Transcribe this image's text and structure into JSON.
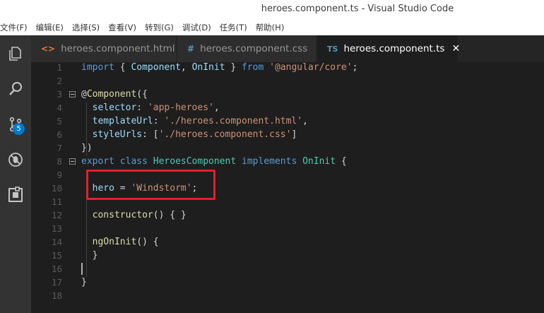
{
  "window": {
    "title": "heroes.component.ts - Visual Studio Code"
  },
  "menu": [
    "文件(F)",
    "编辑(E)",
    "选择(S)",
    "查看(V)",
    "转到(G)",
    "调试(D)",
    "任务(T)",
    "帮助(H)"
  ],
  "activity": {
    "scm_badge": "5"
  },
  "tabs": [
    {
      "icon": "<>",
      "label": "heroes.component.html"
    },
    {
      "icon": "#",
      "label": "heroes.component.css"
    },
    {
      "icon": "TS",
      "label": "heroes.component.ts",
      "close": "✕"
    }
  ],
  "code": {
    "line_numbers": [
      "1",
      "2",
      "3",
      "4",
      "5",
      "6",
      "7",
      "8",
      "9",
      "10",
      "11",
      "12",
      "13",
      "14",
      "15",
      "16",
      "17",
      "18"
    ],
    "l1": [
      "import",
      " { ",
      "Component",
      ", ",
      "OnInit",
      " } ",
      "from",
      " ",
      "'@angular/core'",
      ";"
    ],
    "l3": [
      "@",
      "Component",
      "({"
    ],
    "l4": [
      "  ",
      "selector",
      ": ",
      "'app-heroes'",
      ","
    ],
    "l5": [
      "  ",
      "templateUrl",
      ": ",
      "'./heroes.component.html'",
      ","
    ],
    "l6": [
      "  ",
      "styleUrls",
      ": [",
      "'./heroes.component.css'",
      "]"
    ],
    "l7": [
      "})"
    ],
    "l8": [
      "export",
      " ",
      "class",
      " ",
      "HeroesComponent",
      " ",
      "implements",
      " ",
      "OnInit",
      " {"
    ],
    "l10": [
      "  ",
      "hero",
      " = ",
      "'Windstorm'",
      ";"
    ],
    "l12": [
      "  ",
      "constructor",
      "() { }"
    ],
    "l14": [
      "  ",
      "ngOnInit",
      "() {"
    ],
    "l15": [
      "  }"
    ],
    "l17": [
      "}"
    ]
  }
}
